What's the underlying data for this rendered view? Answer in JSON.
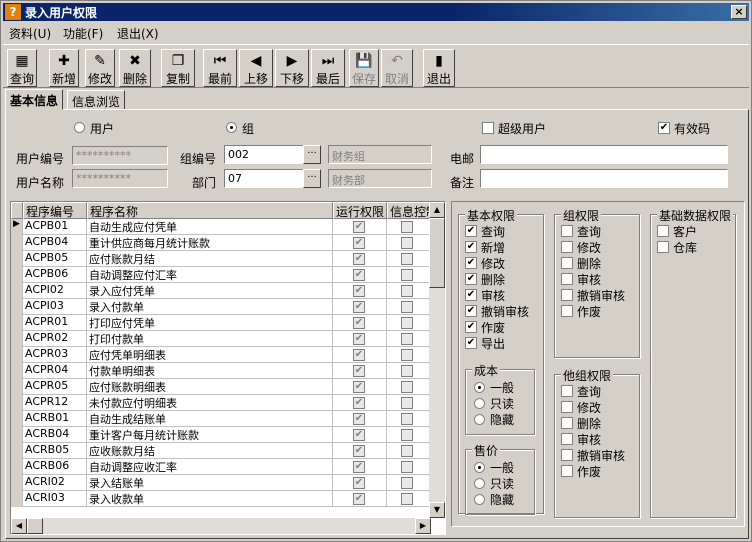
{
  "window": {
    "title": "录入用户权限",
    "close": "×"
  },
  "menu": [
    {
      "label": "资料(U)"
    },
    {
      "label": "功能(F)"
    },
    {
      "label": "退出(X)"
    }
  ],
  "toolbar": [
    {
      "id": "query",
      "label": "查询",
      "icon": "query-icon",
      "glyph": "▦",
      "enabled": true
    },
    {
      "id": "add",
      "label": "新增",
      "icon": "add-icon",
      "glyph": "✚",
      "enabled": true
    },
    {
      "id": "edit",
      "label": "修改",
      "icon": "edit-icon",
      "glyph": "✎",
      "enabled": true
    },
    {
      "id": "delete",
      "label": "删除",
      "icon": "delete-icon",
      "glyph": "✖",
      "enabled": true
    },
    {
      "id": "copy",
      "label": "复制",
      "icon": "copy-icon",
      "glyph": "❐",
      "enabled": true
    },
    {
      "id": "first",
      "label": "最前",
      "icon": "first-icon",
      "glyph": "⏮",
      "enabled": true
    },
    {
      "id": "prev",
      "label": "上移",
      "icon": "prev-icon",
      "glyph": "◀",
      "enabled": true
    },
    {
      "id": "next",
      "label": "下移",
      "icon": "next-icon",
      "glyph": "▶",
      "enabled": true
    },
    {
      "id": "last",
      "label": "最后",
      "icon": "last-icon",
      "glyph": "⏭",
      "enabled": true
    },
    {
      "id": "save",
      "label": "保存",
      "icon": "save-icon",
      "glyph": "💾",
      "enabled": false
    },
    {
      "id": "cancel",
      "label": "取消",
      "icon": "undo-icon",
      "glyph": "↶",
      "enabled": false
    },
    {
      "id": "exit",
      "label": "退出",
      "icon": "exit-icon",
      "glyph": "▮",
      "enabled": true
    }
  ],
  "tabs": [
    {
      "label": "基本信息",
      "active": true
    },
    {
      "label": "信息浏览",
      "active": false
    }
  ],
  "form": {
    "type_user": "用户",
    "type_group": "组",
    "type_selected": "group",
    "super_user": "超级用户",
    "super_user_checked": false,
    "valid_code": "有效码",
    "valid_code_checked": true,
    "user_id_label": "用户编号",
    "user_id_value": "**********",
    "user_name_label": "用户名称",
    "user_name_value": "**********",
    "group_id_label": "组编号",
    "group_id_value": "002",
    "group_name_value": "财务组",
    "dept_label": "部门",
    "dept_value": "07",
    "dept_name_value": "财务部",
    "phone_label": "电邮",
    "phone_value": "",
    "note_label": "备注",
    "note_value": ""
  },
  "grid": {
    "headers": [
      "程序编号",
      "程序名称",
      "运行权限",
      "信息控制"
    ],
    "rows": [
      {
        "code": "ACPB01",
        "name": "自动生成应付凭单",
        "run": true,
        "info": false
      },
      {
        "code": "ACPB04",
        "name": "重计供应商每月统计账款",
        "run": true,
        "info": false
      },
      {
        "code": "ACPB05",
        "name": "应付账款月结",
        "run": true,
        "info": false
      },
      {
        "code": "ACPB06",
        "name": "自动调整应付汇率",
        "run": true,
        "info": false
      },
      {
        "code": "ACPI02",
        "name": "录入应付凭单",
        "run": true,
        "info": false
      },
      {
        "code": "ACPI03",
        "name": "录入付款单",
        "run": true,
        "info": false
      },
      {
        "code": "ACPR01",
        "name": "打印应付凭单",
        "run": true,
        "info": false
      },
      {
        "code": "ACPR02",
        "name": "打印付款单",
        "run": true,
        "info": false
      },
      {
        "code": "ACPR03",
        "name": "应付凭单明细表",
        "run": true,
        "info": false
      },
      {
        "code": "ACPR04",
        "name": "付款单明细表",
        "run": true,
        "info": false
      },
      {
        "code": "ACPR05",
        "name": "应付账款明细表",
        "run": true,
        "info": false
      },
      {
        "code": "ACPR12",
        "name": "未付款应付明细表",
        "run": true,
        "info": false
      },
      {
        "code": "ACRB01",
        "name": "自动生成结账单",
        "run": true,
        "info": false
      },
      {
        "code": "ACRB04",
        "name": "重计客户每月统计账款",
        "run": true,
        "info": false
      },
      {
        "code": "ACRB05",
        "name": "应收账款月结",
        "run": true,
        "info": false
      },
      {
        "code": "ACRB06",
        "name": "自动调整应收汇率",
        "run": true,
        "info": false
      },
      {
        "code": "ACRI02",
        "name": "录入结账单",
        "run": true,
        "info": false
      },
      {
        "code": "ACRI03",
        "name": "录入收款单",
        "run": true,
        "info": false
      }
    ]
  },
  "basic_perm": {
    "title": "基本权限",
    "items": [
      {
        "label": "查询",
        "checked": true
      },
      {
        "label": "新增",
        "checked": true
      },
      {
        "label": "修改",
        "checked": true
      },
      {
        "label": "删除",
        "checked": true
      },
      {
        "label": "审核",
        "checked": true
      },
      {
        "label": "撤销审核",
        "checked": true
      },
      {
        "label": "作废",
        "checked": true
      },
      {
        "label": "导出",
        "checked": true
      }
    ]
  },
  "cost": {
    "title": "成本",
    "options": [
      "一般",
      "只读",
      "隐藏"
    ],
    "selected": 0
  },
  "price": {
    "title": "售价",
    "options": [
      "一般",
      "只读",
      "隐藏"
    ],
    "selected": 0
  },
  "group_perm": {
    "title": "组权限",
    "items": [
      {
        "label": "查询",
        "checked": false
      },
      {
        "label": "修改",
        "checked": false
      },
      {
        "label": "删除",
        "checked": false
      },
      {
        "label": "审核",
        "checked": false
      },
      {
        "label": "撤销审核",
        "checked": false
      },
      {
        "label": "作废",
        "checked": false
      }
    ]
  },
  "other_perm": {
    "title": "他组权限",
    "items": [
      {
        "label": "查询",
        "checked": false
      },
      {
        "label": "修改",
        "checked": false
      },
      {
        "label": "删除",
        "checked": false
      },
      {
        "label": "审核",
        "checked": false
      },
      {
        "label": "撤销审核",
        "checked": false
      },
      {
        "label": "作废",
        "checked": false
      }
    ]
  },
  "base_data_perm": {
    "title": "基础数据权限",
    "items": [
      {
        "label": "客户",
        "checked": false
      },
      {
        "label": "仓库",
        "checked": false
      }
    ]
  }
}
